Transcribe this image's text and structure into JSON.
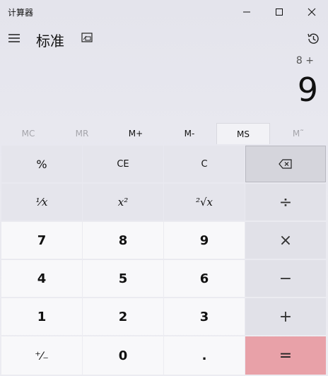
{
  "window": {
    "title": "计算器",
    "minimize": "—",
    "maximize": "☐",
    "close": "✕"
  },
  "header": {
    "mode": "标准"
  },
  "display": {
    "expression": "8 +",
    "value": "9"
  },
  "memory": {
    "mc": "MC",
    "mr": "MR",
    "m_plus": "M+",
    "m_minus": "M-",
    "ms": "MS",
    "m_list": "M˜"
  },
  "keys": {
    "percent": "%",
    "ce": "CE",
    "c": "C",
    "backspace": "⌫",
    "reciprocal": "¹⁄x",
    "square": "x²",
    "sqrt": "²√x",
    "divide": "÷",
    "seven": "7",
    "eight": "8",
    "nine": "9",
    "multiply": "×",
    "four": "4",
    "five": "5",
    "six": "6",
    "minus": "−",
    "one": "1",
    "two": "2",
    "three": "3",
    "plus": "+",
    "negate": "⁺⁄₋",
    "zero": "0",
    "decimal": ".",
    "equals": "="
  }
}
